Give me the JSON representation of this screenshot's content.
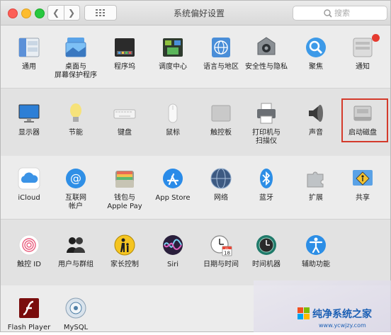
{
  "window": {
    "title": "系统偏好设置"
  },
  "search": {
    "placeholder": "搜索"
  },
  "rows": [
    [
      {
        "label": "通用",
        "icon": "general-icon"
      },
      {
        "label": "桌面与\n屏幕保护程序",
        "icon": "desktop-screensaver-icon"
      },
      {
        "label": "程序坞",
        "icon": "dock-icon"
      },
      {
        "label": "调度中心",
        "icon": "mission-control-icon"
      },
      {
        "label": "语言与地区",
        "icon": "language-region-icon"
      },
      {
        "label": "安全性与隐私",
        "icon": "security-privacy-icon"
      },
      {
        "label": "聚焦",
        "icon": "spotlight-icon"
      },
      {
        "label": "通知",
        "icon": "notifications-icon"
      }
    ],
    [
      {
        "label": "显示器",
        "icon": "displays-icon"
      },
      {
        "label": "节能",
        "icon": "energy-saver-icon"
      },
      {
        "label": "键盘",
        "icon": "keyboard-icon"
      },
      {
        "label": "鼠标",
        "icon": "mouse-icon"
      },
      {
        "label": "触控板",
        "icon": "trackpad-icon"
      },
      {
        "label": "打印机与\n扫描仪",
        "icon": "printers-scanners-icon"
      },
      {
        "label": "声音",
        "icon": "sound-icon"
      },
      {
        "label": "启动磁盘",
        "icon": "startup-disk-icon"
      }
    ],
    [
      {
        "label": "iCloud",
        "icon": "icloud-icon"
      },
      {
        "label": "互联网\n帐户",
        "icon": "internet-accounts-icon"
      },
      {
        "label": "钱包与\nApple Pay",
        "icon": "wallet-applepay-icon"
      },
      {
        "label": "App Store",
        "icon": "app-store-icon"
      },
      {
        "label": "网络",
        "icon": "network-icon"
      },
      {
        "label": "蓝牙",
        "icon": "bluetooth-icon"
      },
      {
        "label": "扩展",
        "icon": "extensions-icon"
      },
      {
        "label": "共享",
        "icon": "sharing-icon"
      }
    ],
    [
      {
        "label": "触控 ID",
        "icon": "touch-id-icon"
      },
      {
        "label": "用户与群组",
        "icon": "users-groups-icon"
      },
      {
        "label": "家长控制",
        "icon": "parental-controls-icon"
      },
      {
        "label": "Siri",
        "icon": "siri-icon"
      },
      {
        "label": "日期与时间",
        "icon": "date-time-icon"
      },
      {
        "label": "时间机器",
        "icon": "time-machine-icon"
      },
      {
        "label": "辅助功能",
        "icon": "accessibility-icon"
      }
    ],
    [
      {
        "label": "Flash Player",
        "icon": "flash-player-icon"
      },
      {
        "label": "MySQL",
        "icon": "mysql-icon"
      }
    ]
  ],
  "calendar_badge": {
    "month": "JUL",
    "day": "18"
  },
  "highlighted_pane": "启动磁盘",
  "watermark": {
    "name": "纯净系统之家",
    "url": "www.ycwjzy.com"
  },
  "colors": {
    "highlight": "#d43a2b",
    "close": "#fc5f57",
    "minimize": "#fdbc2e",
    "zoom": "#28c840"
  }
}
